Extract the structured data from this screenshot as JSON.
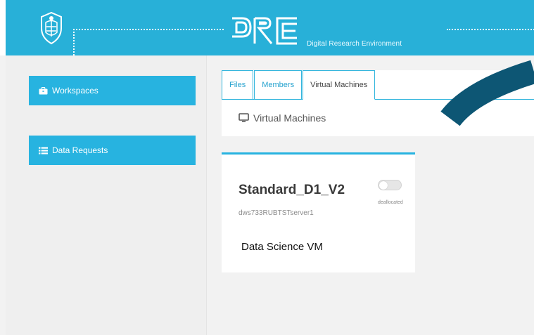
{
  "header": {
    "logo_text": "DRE",
    "logo_subtitle": "Digital Research Environment",
    "bg_color": "#28b0d8"
  },
  "sidebar": {
    "items": [
      {
        "label": "Workspaces",
        "icon": "briefcase-icon"
      },
      {
        "label": "Data Requests",
        "icon": "list-icon"
      }
    ]
  },
  "tabs": [
    {
      "label": "Files",
      "active": false
    },
    {
      "label": "Members",
      "active": false
    },
    {
      "label": "Virtual Machines",
      "active": true
    }
  ],
  "section": {
    "title": "Virtual Machines",
    "icon": "monitor-icon"
  },
  "vm": {
    "name": "Standard_D1_V2",
    "server": "dws733RUBTSTserver1",
    "status": "deallocated",
    "description": "Data Science VM",
    "power_on": false
  },
  "colors": {
    "accent": "#27b3e0",
    "arrow": "#0d5674"
  }
}
